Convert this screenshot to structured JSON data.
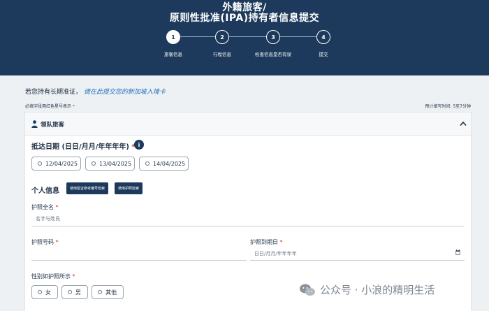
{
  "header": {
    "title_line1": "外籍旅客/",
    "title_line2": "原则性批准(IPA)持有者信息提交",
    "steps": [
      {
        "num": "1",
        "label": "旅客信息"
      },
      {
        "num": "2",
        "label": "行程信息"
      },
      {
        "num": "3",
        "label": "检查信息是否有误"
      },
      {
        "num": "4",
        "label": "提交"
      }
    ]
  },
  "notice": {
    "text": "若您持有长期准证，",
    "link": "请在此提交您的新加坡入境卡"
  },
  "required_note": "必填字段用红色星号表示",
  "required_star": "*",
  "est_time": "预计填写时间: 5至7分钟",
  "card": {
    "title": "领队旅客",
    "arrival_label": "抵达日期 (日日/月月/年年年年)",
    "dates": [
      "12/04/2025",
      "13/04/2025",
      "14/04/2025"
    ],
    "personal_label": "个人信息",
    "pill1": "使用签证参考编号检索",
    "pill2": "使用护照检索",
    "fullname_label": "护照全名",
    "fullname_placeholder": "名字与姓氏",
    "passport_no_label": "护照号码",
    "passport_exp_label": "护照到期日",
    "passport_exp_placeholder": "日日/月月/年年年年",
    "gender_label": "性别如护照所示",
    "genders": [
      "女",
      "男",
      "其他"
    ]
  },
  "watermark": "公众号 · 小浪的精明生活",
  "colors": {
    "navy": "#1d3a5c",
    "link": "#1b6fbf",
    "required": "#c0392b"
  }
}
